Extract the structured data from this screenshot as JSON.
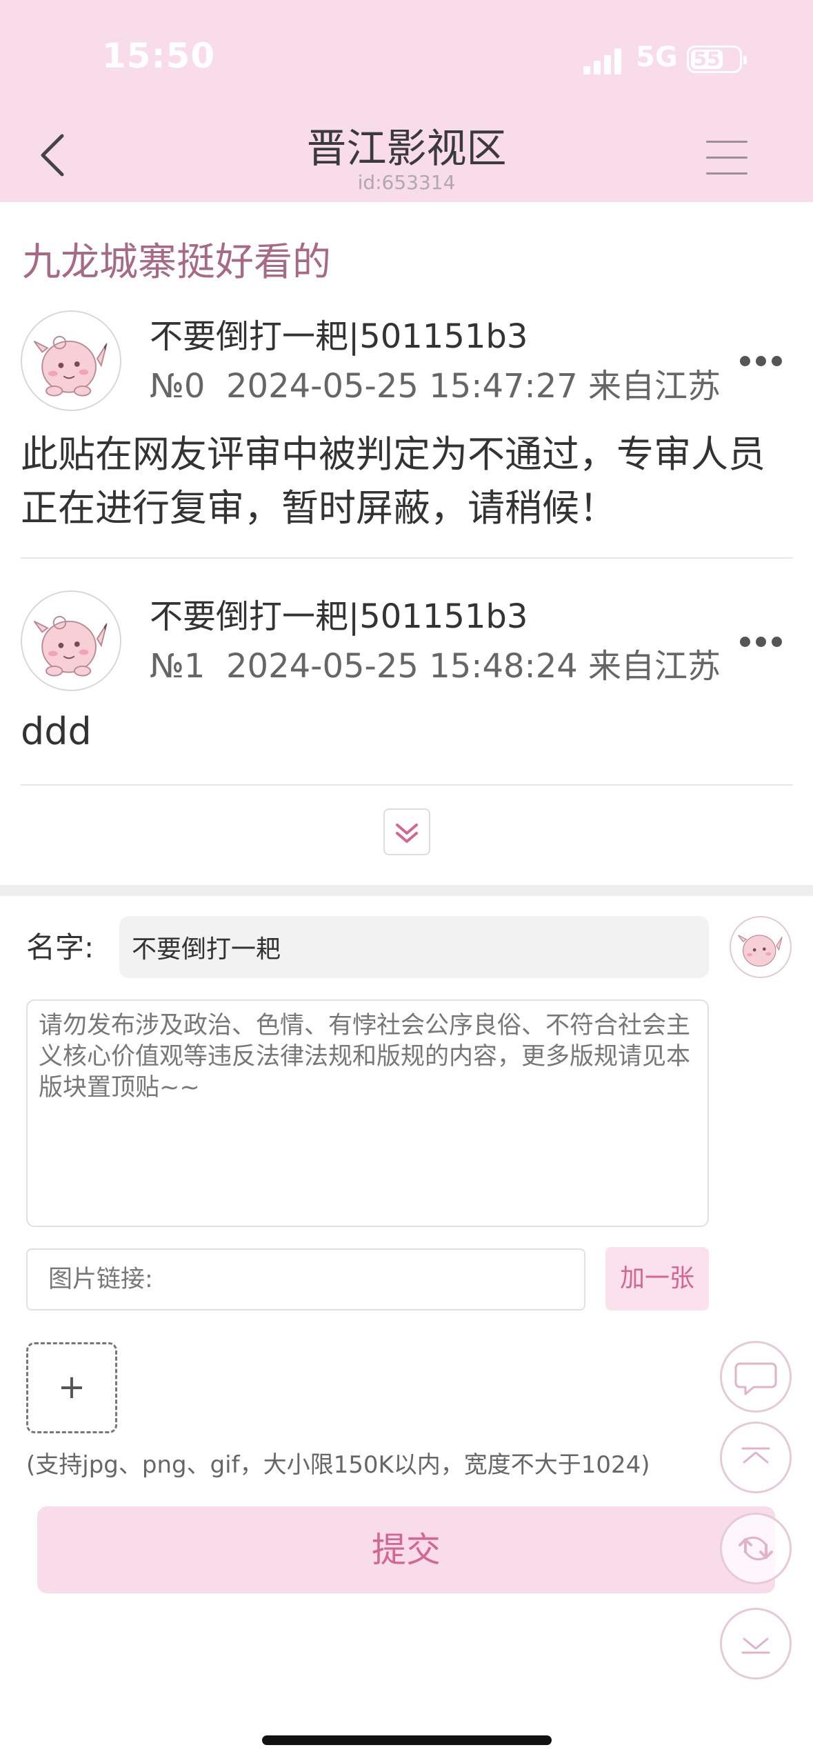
{
  "status_bar": {
    "time": "15:50",
    "network": "5G",
    "battery": "55"
  },
  "header": {
    "title": "晋江影视区",
    "id_label": "id:653314"
  },
  "thread": {
    "title": "九龙城寨挺好看的",
    "posts": [
      {
        "username": "不要倒打一耙",
        "user_code": "|501151b3",
        "floor": "№0",
        "datetime": "2024-05-25 15:47:27",
        "location": "来自江苏",
        "body": "此贴在网友评审中被判定为不通过，专审人员正在进行复审，暂时屏蔽，请稍候！"
      },
      {
        "username": "不要倒打一耙",
        "user_code": "|501151b3",
        "floor": "№1",
        "datetime": "2024-05-25 15:48:24",
        "location": "来自江苏",
        "body": "ddd"
      }
    ]
  },
  "reply_form": {
    "name_label": "名字:",
    "name_value": "不要倒打一耙",
    "content_placeholder": "请勿发布涉及政治、色情、有悖社会公序良俗、不符合社会主义核心价值观等违反法律法规和版规的内容，更多版规请见本版块置顶贴~~",
    "image_link_placeholder": "图片链接:",
    "add_one_label": "加一张",
    "upload_plus": "+",
    "upload_hint": "(支持jpg、png、gif，大小限150K以内，宽度不大于1024)",
    "submit_label": "提交"
  },
  "icons": {
    "back": "chevron-left-icon",
    "menu": "hamburger-menu-icon",
    "more": "more-dots-icon",
    "expand": "double-chevron-down-icon",
    "comment": "comment-bubble-icon",
    "to_top": "arrow-up-icon",
    "refresh": "refresh-icon",
    "to_bottom": "arrow-down-icon"
  },
  "colors": {
    "header_bg": "#f9dcea",
    "accent": "#d46694",
    "thread_title": "#a66a86"
  }
}
